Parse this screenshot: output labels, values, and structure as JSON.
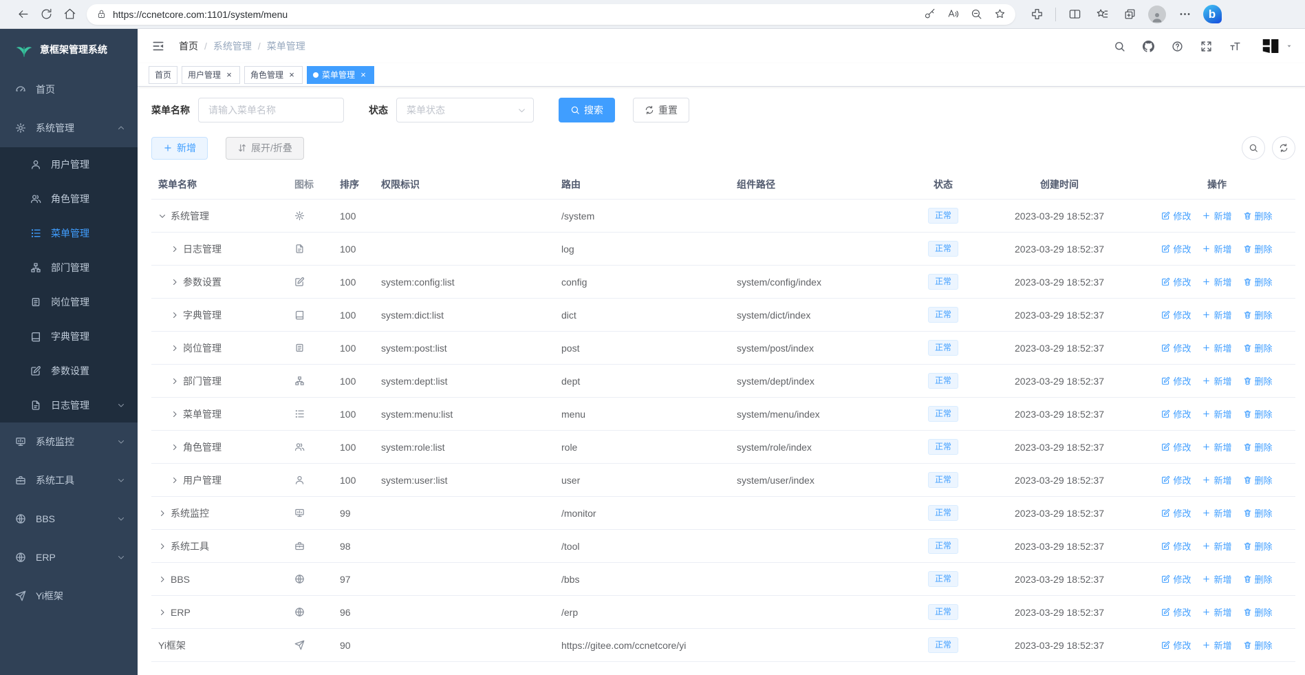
{
  "browser": {
    "url": "https://ccnetcore.com:1101/system/menu",
    "left_icons": [
      "back",
      "reload",
      "home"
    ],
    "pill_icons": [
      "lock",
      "password-key",
      "read-aloud",
      "zoom-out",
      "favorite-star-add"
    ],
    "right_icons": [
      "extensions",
      "split-screen",
      "favorites-hub",
      "collections",
      "profile-avatar",
      "more-dots",
      "bing-chat"
    ],
    "bing_letter": "b"
  },
  "sidebar": {
    "logo_title": "意框架管理系统",
    "logo_icon": "leaf",
    "items": [
      {
        "label": "首页",
        "icon": "dashboard",
        "type": "top"
      },
      {
        "label": "系统管理",
        "icon": "gear",
        "type": "top",
        "arrow": "up"
      },
      {
        "label": "用户管理",
        "icon": "user",
        "type": "sub"
      },
      {
        "label": "角色管理",
        "icon": "users",
        "type": "sub"
      },
      {
        "label": "菜单管理",
        "icon": "menutree",
        "type": "sub",
        "active": true
      },
      {
        "label": "部门管理",
        "icon": "orgtree",
        "type": "sub"
      },
      {
        "label": "岗位管理",
        "icon": "badge",
        "type": "sub"
      },
      {
        "label": "字典管理",
        "icon": "book",
        "type": "sub"
      },
      {
        "label": "参数设置",
        "icon": "edit",
        "type": "sub"
      },
      {
        "label": "日志管理",
        "icon": "log",
        "type": "sub",
        "arrow": "down"
      },
      {
        "label": "系统监控",
        "icon": "monitor",
        "type": "top",
        "arrow": "down"
      },
      {
        "label": "系统工具",
        "icon": "toolbox",
        "type": "top",
        "arrow": "down"
      },
      {
        "label": "BBS",
        "icon": "globe",
        "type": "top",
        "arrow": "down"
      },
      {
        "label": "ERP",
        "icon": "globe",
        "type": "top",
        "arrow": "down"
      },
      {
        "label": "Yi框架",
        "icon": "send",
        "type": "top"
      }
    ]
  },
  "navbar": {
    "breadcrumb": [
      "首页",
      "系统管理",
      "菜单管理"
    ],
    "icons": [
      "fold-menu",
      "search",
      "github",
      "question",
      "fullscreen",
      "font-size"
    ],
    "user_logo": "yi-logo"
  },
  "tabs": [
    {
      "label": "首页",
      "closable": false,
      "active": false
    },
    {
      "label": "用户管理",
      "closable": true,
      "active": false
    },
    {
      "label": "角色管理",
      "closable": true,
      "active": false
    },
    {
      "label": "菜单管理",
      "closable": true,
      "active": true
    }
  ],
  "filters": {
    "name_label": "菜单名称",
    "name_placeholder": "请输入菜单名称",
    "status_label": "状态",
    "status_placeholder": "菜单状态",
    "search_label": "搜索",
    "reset_label": "重置"
  },
  "toolbar": {
    "add_label": "新增",
    "fold_label": "展开/折叠"
  },
  "table": {
    "columns": [
      "菜单名称",
      "图标",
      "排序",
      "权限标识",
      "路由",
      "组件路径",
      "状态",
      "创建时间",
      "操作"
    ],
    "action_labels": {
      "edit": "修改",
      "add": "新增",
      "delete": "删除"
    },
    "rows": [
      {
        "name": "系统管理",
        "icon": "gear",
        "level": 0,
        "expand": "open",
        "order": "100",
        "perm": "",
        "route": "/system",
        "component": "",
        "status": "正常",
        "created": "2023-03-29 18:52:37"
      },
      {
        "name": "日志管理",
        "icon": "log",
        "level": 1,
        "expand": "closed",
        "order": "100",
        "perm": "",
        "route": "log",
        "component": "",
        "status": "正常",
        "created": "2023-03-29 18:52:37"
      },
      {
        "name": "参数设置",
        "icon": "edit",
        "level": 1,
        "expand": "closed",
        "order": "100",
        "perm": "system:config:list",
        "route": "config",
        "component": "system/config/index",
        "status": "正常",
        "created": "2023-03-29 18:52:37"
      },
      {
        "name": "字典管理",
        "icon": "book",
        "level": 1,
        "expand": "closed",
        "order": "100",
        "perm": "system:dict:list",
        "route": "dict",
        "component": "system/dict/index",
        "status": "正常",
        "created": "2023-03-29 18:52:37"
      },
      {
        "name": "岗位管理",
        "icon": "badge",
        "level": 1,
        "expand": "closed",
        "order": "100",
        "perm": "system:post:list",
        "route": "post",
        "component": "system/post/index",
        "status": "正常",
        "created": "2023-03-29 18:52:37"
      },
      {
        "name": "部门管理",
        "icon": "orgtree",
        "level": 1,
        "expand": "closed",
        "order": "100",
        "perm": "system:dept:list",
        "route": "dept",
        "component": "system/dept/index",
        "status": "正常",
        "created": "2023-03-29 18:52:37"
      },
      {
        "name": "菜单管理",
        "icon": "menutree",
        "level": 1,
        "expand": "closed",
        "order": "100",
        "perm": "system:menu:list",
        "route": "menu",
        "component": "system/menu/index",
        "status": "正常",
        "created": "2023-03-29 18:52:37"
      },
      {
        "name": "角色管理",
        "icon": "users",
        "level": 1,
        "expand": "closed",
        "order": "100",
        "perm": "system:role:list",
        "route": "role",
        "component": "system/role/index",
        "status": "正常",
        "created": "2023-03-29 18:52:37"
      },
      {
        "name": "用户管理",
        "icon": "user",
        "level": 1,
        "expand": "closed",
        "order": "100",
        "perm": "system:user:list",
        "route": "user",
        "component": "system/user/index",
        "status": "正常",
        "created": "2023-03-29 18:52:37"
      },
      {
        "name": "系统监控",
        "icon": "monitor",
        "level": 0,
        "expand": "closed",
        "order": "99",
        "perm": "",
        "route": "/monitor",
        "component": "",
        "status": "正常",
        "created": "2023-03-29 18:52:37"
      },
      {
        "name": "系统工具",
        "icon": "toolbox",
        "level": 0,
        "expand": "closed",
        "order": "98",
        "perm": "",
        "route": "/tool",
        "component": "",
        "status": "正常",
        "created": "2023-03-29 18:52:37"
      },
      {
        "name": "BBS",
        "icon": "globe",
        "level": 0,
        "expand": "closed",
        "order": "97",
        "perm": "",
        "route": "/bbs",
        "component": "",
        "status": "正常",
        "created": "2023-03-29 18:52:37"
      },
      {
        "name": "ERP",
        "icon": "globe",
        "level": 0,
        "expand": "closed",
        "order": "96",
        "perm": "",
        "route": "/erp",
        "component": "",
        "status": "正常",
        "created": "2023-03-29 18:52:37"
      },
      {
        "name": "Yi框架",
        "icon": "send",
        "level": 0,
        "expand": "none",
        "order": "90",
        "perm": "",
        "route": "https://gitee.com/ccnetcore/yi",
        "component": "",
        "status": "正常",
        "created": "2023-03-29 18:52:37"
      }
    ]
  },
  "colors": {
    "accent": "#409eff",
    "sidebar_bg": "#304156",
    "sidebar_sub_bg": "#1f2d3d",
    "badge_bg": "#ecf5ff",
    "badge_border": "#d9ecff",
    "tab_active_bg": "#409eff"
  }
}
